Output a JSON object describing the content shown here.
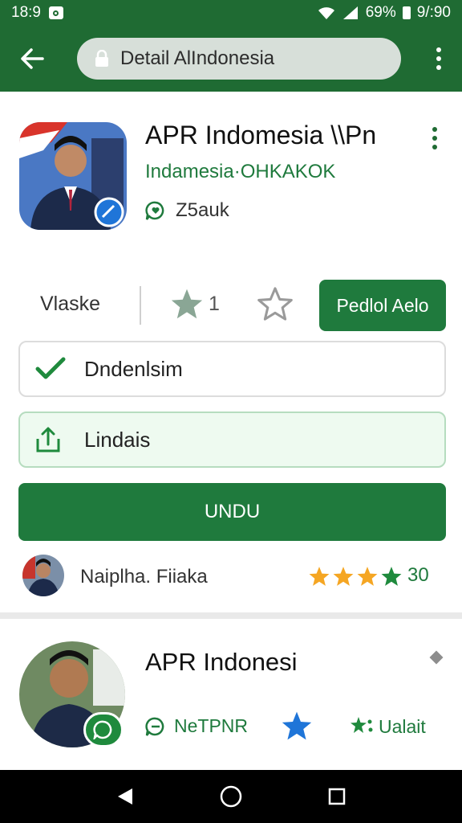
{
  "status_bar": {
    "time": "18:9",
    "battery_percent": "69%",
    "clock_right": "9/:90"
  },
  "app_bar": {
    "url_text": "Detail AlIndonesia"
  },
  "app": {
    "title": "APR Indomesia \\\\Pn",
    "developer": "Indamesia·OHKAKOK",
    "size_label": "Z5auk"
  },
  "actions": {
    "left_label": "Vlaske",
    "star_count": "1",
    "primary_button": "Pedlol Aelo"
  },
  "options": [
    {
      "label": "Dndenlsim",
      "icon": "check-icon"
    },
    {
      "label": "Lindais",
      "icon": "share-icon"
    }
  ],
  "main_button": {
    "label": "UNDU"
  },
  "reviewer": {
    "name": "Naiplha. Fiiaka",
    "count": "30",
    "stars": 4
  },
  "card2": {
    "title": "APR Indonesi",
    "tag": "NeTPNR",
    "link": "Ualait"
  },
  "colors": {
    "primary_green": "#1f7a3d",
    "header_green": "#1f6b33",
    "star_gold": "#f5a623",
    "star_blue": "#1f75d8"
  }
}
